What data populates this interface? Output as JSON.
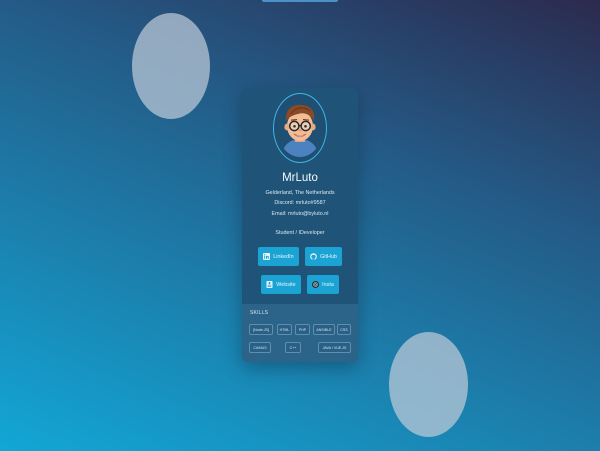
{
  "profile": {
    "name": "MrLuto",
    "location": "Gelderland, The Netherlands",
    "discord": "Discord: mrluto#9587",
    "email": "Email: mrluto@byluto.nl",
    "role": "Student / IDeveloper",
    "avatar": "memoji-avatar"
  },
  "links": [
    {
      "label": "LinkedIn",
      "icon": "linkedin-icon"
    },
    {
      "label": "GitHub",
      "icon": "github-icon"
    },
    {
      "label": "Website",
      "icon": "website-icon"
    },
    {
      "label": "Insta",
      "icon": "instagram-icon"
    }
  ],
  "skills": {
    "title": "SKILLS",
    "items": [
      "[Node.JS]",
      "HTML",
      "PHP",
      "ANSIBLE",
      "CSS",
      "C#/NUS",
      "C++",
      "JAVA / VUE.JS"
    ]
  },
  "colors": {
    "card": "#1f5377",
    "button": "#1aa3d3",
    "skills_panel": "#2c6489",
    "avatar_ring": "#3fb4e3"
  }
}
